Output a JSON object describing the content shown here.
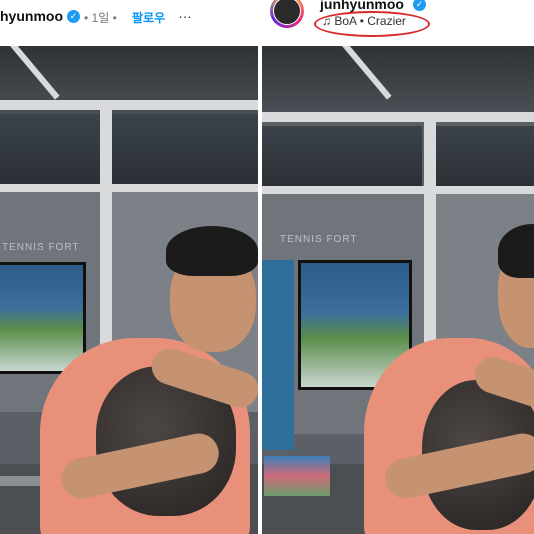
{
  "left_post": {
    "username": "hyunmoo",
    "meta": "• 1일 •",
    "follow_label": "팔로우",
    "more_label": "…",
    "photo_sign": "TENNIS FORT"
  },
  "right_post": {
    "username": "junhyunmoo",
    "music_icon": "music-note-icon",
    "music": "BoA • Crazier",
    "photo_sign": "TENNIS FORT"
  },
  "colors": {
    "verified": "#1d9bf0",
    "follow": "#0095f6",
    "highlight_oval": "#d92a2a",
    "shirt": "#e9907a"
  }
}
